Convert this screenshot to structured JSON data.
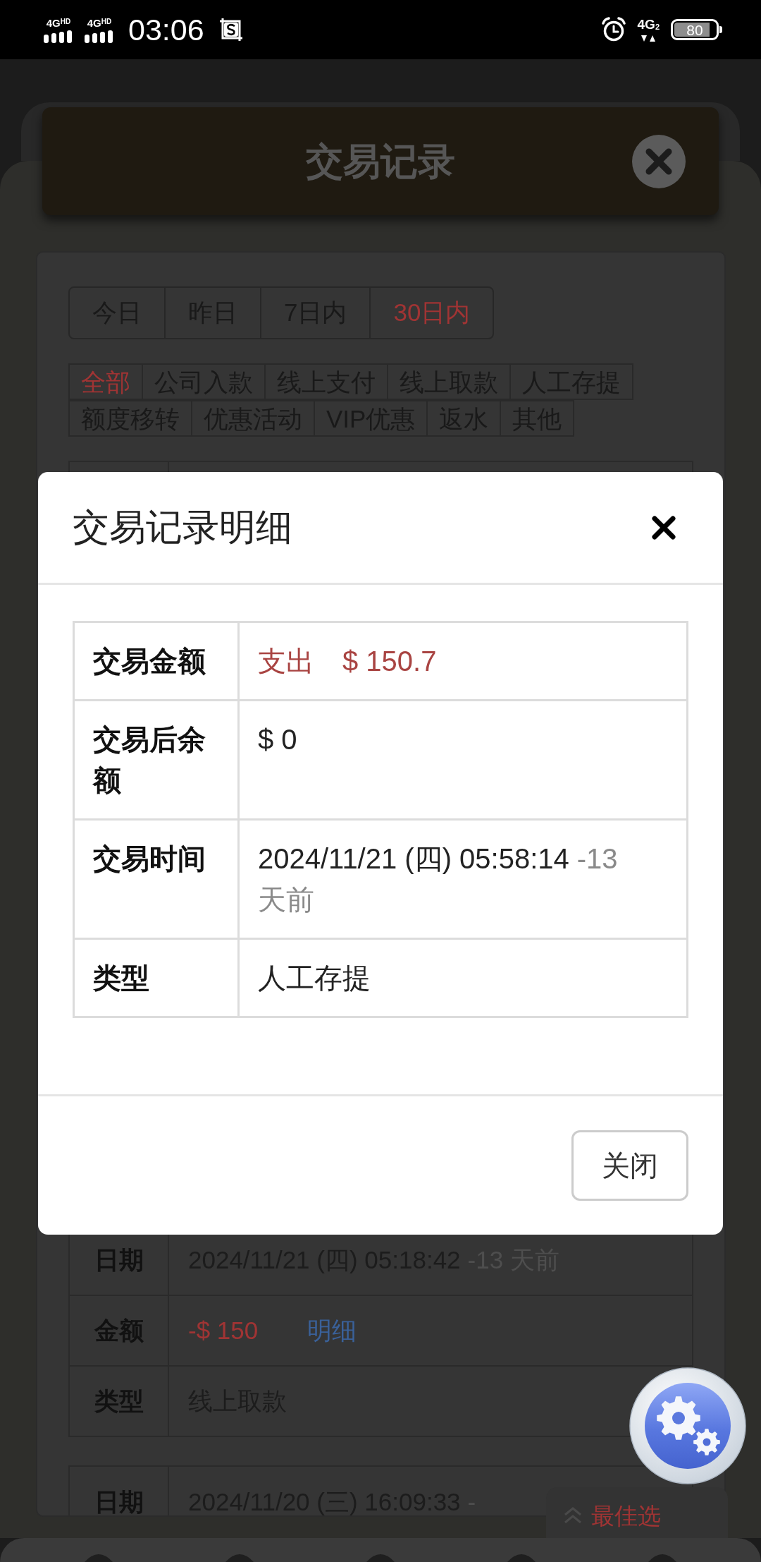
{
  "status_bar": {
    "network_labels": [
      "4G$^{HD}$",
      "4G$^{HD}$"
    ],
    "time": "03:06",
    "network_type": "4G$_{2}$",
    "battery": "80"
  },
  "header": {
    "title": "交易记录"
  },
  "date_tabs": [
    {
      "label": "今日",
      "selected": false
    },
    {
      "label": "昨日",
      "selected": false
    },
    {
      "label": "7日内",
      "selected": false
    },
    {
      "label": "30日内",
      "selected": true
    }
  ],
  "category_tabs": [
    {
      "label": "全部",
      "selected": true
    },
    {
      "label": "公司入款",
      "selected": false
    },
    {
      "label": "线上支付",
      "selected": false
    },
    {
      "label": "线上取款",
      "selected": false
    },
    {
      "label": "人工存提",
      "selected": false
    },
    {
      "label": "额度移转",
      "selected": false
    },
    {
      "label": "优惠活动",
      "selected": false
    },
    {
      "label": "VIP优惠",
      "selected": false
    },
    {
      "label": "返水",
      "selected": false
    },
    {
      "label": "其他",
      "selected": false
    }
  ],
  "records": [
    {
      "fields": [
        {
          "kind": "date",
          "label": "日期",
          "value": "2024/11/21 (四) 05:18:42",
          "ago": "-13 天前"
        },
        {
          "kind": "amount",
          "label": "金额",
          "value": "-$ 150",
          "link": "明细"
        },
        {
          "kind": "text",
          "label": "类型",
          "value": "线上取款"
        }
      ]
    },
    {
      "fields": [
        {
          "kind": "date",
          "label": "日期",
          "value": "2024/11/20 (三) 16:09:33",
          "ago": "-"
        }
      ]
    }
  ],
  "floating_tab": {
    "label": "最佳选"
  },
  "dialog": {
    "title": "交易记录明细",
    "rows": [
      {
        "kind": "amount",
        "label": "交易金额",
        "direction": "支出",
        "value": "$ 150.7"
      },
      {
        "kind": "text",
        "label": "交易后余额",
        "value": "$ 0"
      },
      {
        "kind": "date",
        "label": "交易时间",
        "value": "2024/11/21 (四) 05:58:14",
        "ago": "-13 天前"
      },
      {
        "kind": "text",
        "label": "类型",
        "value": "人工存提"
      }
    ],
    "close_button": "关闭"
  }
}
